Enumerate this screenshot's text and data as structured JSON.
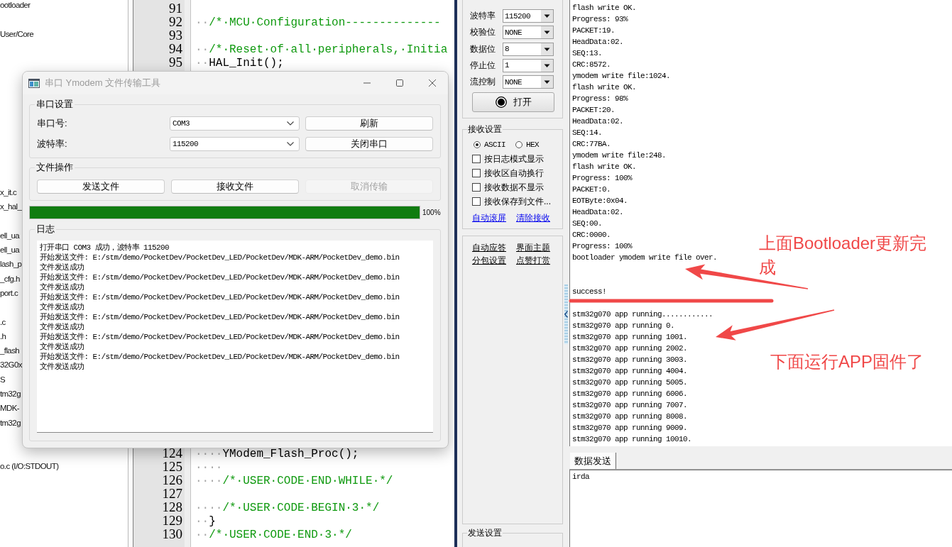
{
  "project_tree": {
    "items": [
      "ootloader",
      "User/Core",
      "x_it.c",
      "x_hal_",
      "ell_ua",
      "ell_ua",
      "lash_p",
      "_cfg.h",
      "port.c",
      ".c",
      ".h",
      "_flash",
      "32G0x",
      "S",
      "tm32g",
      "MDK-",
      "tm32g",
      "o.c (I/O:STDOUT)"
    ]
  },
  "editor": {
    "top_lines": [
      {
        "number": "91"
      },
      {
        "number": "92",
        "segments": [
          {
            "kind": "space",
            "text": "··"
          },
          {
            "kind": "comment",
            "text": "/*·MCU·Configuration--------------"
          }
        ]
      },
      {
        "number": "93"
      },
      {
        "number": "94",
        "segments": [
          {
            "kind": "space",
            "text": "··"
          },
          {
            "kind": "comment",
            "text": "/*·Reset·of·all·peripherals,·Initia"
          }
        ]
      },
      {
        "number": "95",
        "segments": [
          {
            "kind": "space",
            "text": "··"
          },
          {
            "kind": "code",
            "text": "HAL_Init();"
          }
        ]
      }
    ],
    "bottom_lines": [
      {
        "number": "124",
        "segments": [
          {
            "kind": "space",
            "text": "····"
          },
          {
            "kind": "code",
            "text": "YModem_Flash_Proc();"
          }
        ]
      },
      {
        "number": "125",
        "segments": [
          {
            "kind": "space",
            "text": "····"
          }
        ]
      },
      {
        "number": "126",
        "segments": [
          {
            "kind": "space",
            "text": "····"
          },
          {
            "kind": "comment",
            "text": "/*·USER·CODE·END·WHILE·*/"
          }
        ]
      },
      {
        "number": "127"
      },
      {
        "number": "128",
        "segments": [
          {
            "kind": "space",
            "text": "····"
          },
          {
            "kind": "comment",
            "text": "/*·USER·CODE·BEGIN·3·*/"
          }
        ]
      },
      {
        "number": "129",
        "segments": [
          {
            "kind": "space",
            "text": "··"
          },
          {
            "kind": "code",
            "text": "}"
          }
        ]
      },
      {
        "number": "130",
        "segments": [
          {
            "kind": "space",
            "text": "··"
          },
          {
            "kind": "comment",
            "text": "/*·USER·CODE·END·3·*/"
          }
        ]
      }
    ]
  },
  "dialog": {
    "title": "串口 Ymodem 文件传输工具",
    "active": false,
    "port_settings": {
      "title": "串口设置",
      "rows": [
        {
          "label": "串口号:",
          "value": "COM3",
          "button": "刷新"
        },
        {
          "label": "波特率:",
          "value": "115200",
          "button": "关闭串口"
        }
      ]
    },
    "file_operations": {
      "title": "文件操作",
      "buttons": [
        {
          "label": "发送文件",
          "disabled": false
        },
        {
          "label": "接收文件",
          "disabled": false
        },
        {
          "label": "取消传输",
          "disabled": true
        }
      ]
    },
    "progress": {
      "level": 1,
      "reading": "100%"
    },
    "log": {
      "title": "日志",
      "lines": [
        "打开串口 COM3 成功，波特率 115200",
        "开始发送文件: E:/stm/demo/PocketDev/PocketDev_LED/PocketDev/MDK-ARM/PocketDev_demo.bin",
        "文件发送成功",
        "开始发送文件: E:/stm/demo/PocketDev/PocketDev_LED/PocketDev/MDK-ARM/PocketDev_demo.bin",
        "文件发送成功",
        "开始发送文件: E:/stm/demo/PocketDev/PocketDev_LED/PocketDev/MDK-ARM/PocketDev_demo.bin",
        "文件发送成功",
        "开始发送文件: E:/stm/demo/PocketDev/PocketDev_LED/PocketDev/MDK-ARM/PocketDev_demo.bin",
        "文件发送成功",
        "开始发送文件: E:/stm/demo/PocketDev/PocketDev_LED/PocketDev/MDK-ARM/PocketDev_demo.bin",
        "文件发送成功",
        "开始发送文件: E:/stm/demo/PocketDev/PocketDev_LED/PocketDev/MDK-ARM/PocketDev_demo.bin",
        "文件发送成功"
      ]
    }
  },
  "serial_tool": {
    "settings": [
      {
        "label": "波特率",
        "value": "115200"
      },
      {
        "label": "校验位",
        "value": "NONE"
      },
      {
        "label": "数据位",
        "value": "8"
      },
      {
        "label": "停止位",
        "value": "1"
      },
      {
        "label": "流控制",
        "value": "NONE"
      }
    ],
    "open_button": {
      "label": "打开"
    },
    "receive_group": {
      "title": "接收设置",
      "modes": [
        {
          "label": "ASCII",
          "selected": true
        },
        {
          "label": "HEX",
          "selected": false
        }
      ],
      "options": [
        {
          "label": "按日志模式显示",
          "checked": false
        },
        {
          "label": "接收区自动换行",
          "checked": false
        },
        {
          "label": "接收数据不显示",
          "checked": false
        },
        {
          "label": "接收保存到文件...",
          "checked": false
        }
      ],
      "links": [
        "自动滚屏",
        "清除接收"
      ]
    },
    "extra_links": [
      "自动应答",
      "界面主题",
      "分包设置",
      "点赞打赏"
    ],
    "send_group": {
      "title": "发送设置"
    },
    "receive_log": {
      "blocks": [
        [
          "flash write OK.",
          "Progress: 93%",
          "PACKET:19.",
          "HeadData:02.",
          "SEQ:13.",
          "CRC:8572.",
          "ymodem write file:1024.",
          "flash write OK.",
          "Progress: 98%",
          "PACKET:20.",
          "HeadData:02.",
          "SEQ:14.",
          "CRC:77BA.",
          "ymodem write file:248.",
          "flash write OK.",
          "Progress: 100%",
          "PACKET:0.",
          "EOTByte:0x04.",
          "HeadData:02.",
          "SEQ:00.",
          "CRC:0000.",
          "Progress: 100%",
          "bootloader ymodem write file over."
        ],
        [
          "success!"
        ],
        [
          "stm32g070 app running............",
          "stm32g070 app running 0.",
          "stm32g070 app running 1001.",
          "stm32g070 app running 2002.",
          "stm32g070 app running 3003.",
          "stm32g070 app running 4004.",
          "stm32g070 app running 5005.",
          "stm32g070 app running 6006.",
          "stm32g070 app running 7007.",
          "stm32g070 app running 8008.",
          "stm32g070 app running 9009.",
          "stm32g070 app running 10010."
        ]
      ]
    },
    "send_tabs": [
      {
        "label": "数据发送",
        "selected": true
      }
    ],
    "send_input": {
      "value": "irda"
    }
  },
  "annotations": [
    {
      "text": "上面Bootloader更新完成"
    },
    {
      "text": "下面运行APP固件了"
    }
  ]
}
